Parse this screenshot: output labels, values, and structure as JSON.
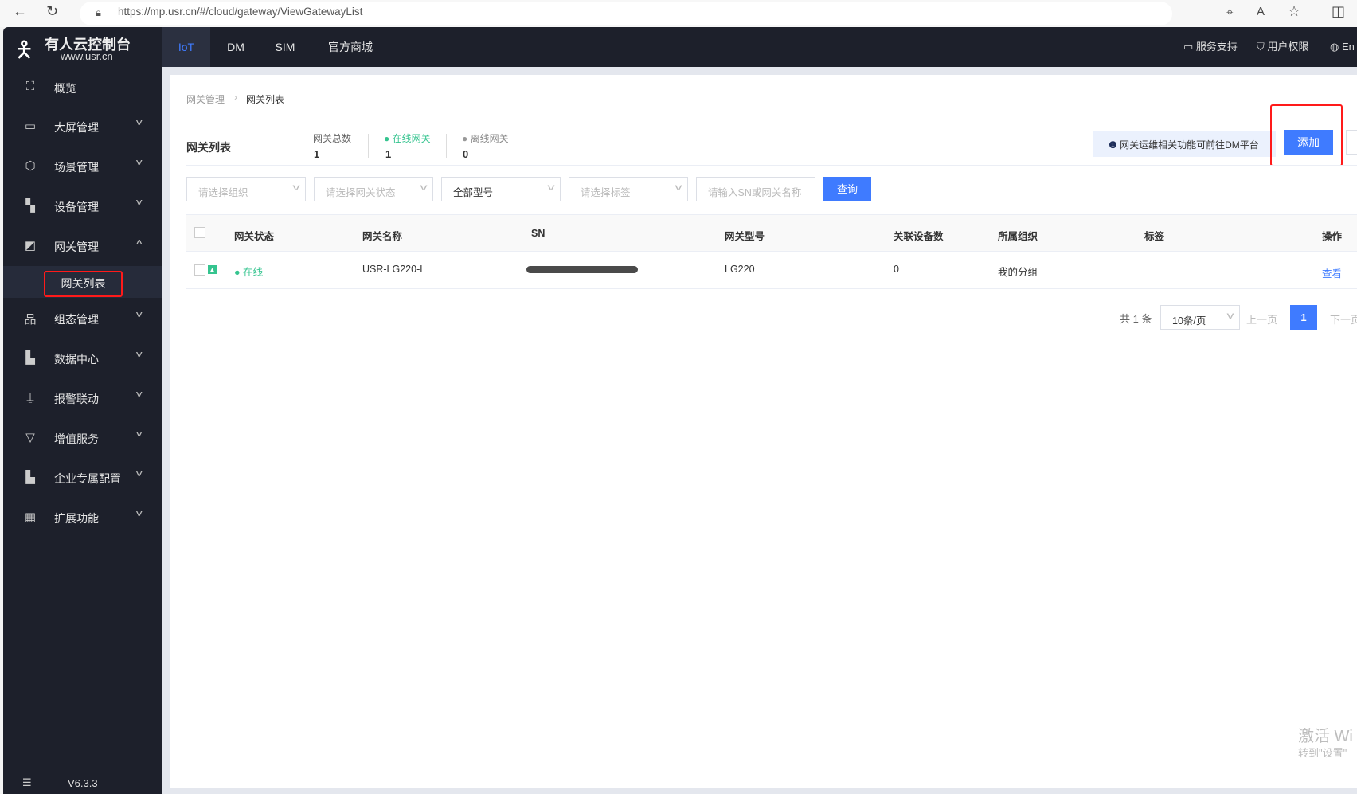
{
  "browser": {
    "url": "https://mp.usr.cn/#/cloud/gateway/ViewGatewayList"
  },
  "logo": {
    "title": "有人云控制台",
    "subtitle": "www.usr.cn"
  },
  "topnav": {
    "tabs": [
      "IoT",
      "DM",
      "SIM",
      "官方商城"
    ],
    "active": "IoT",
    "right": [
      "服务支持",
      "用户权限",
      "En"
    ]
  },
  "sidebar": {
    "items": [
      {
        "label": "概览",
        "icon": "overview-icon"
      },
      {
        "label": "大屏管理",
        "icon": "screen-icon"
      },
      {
        "label": "场景管理",
        "icon": "scene-icon"
      },
      {
        "label": "设备管理",
        "icon": "device-icon"
      },
      {
        "label": "网关管理",
        "icon": "gateway-icon",
        "expanded": true
      },
      {
        "label": "组态管理",
        "icon": "config-icon"
      },
      {
        "label": "数据中心",
        "icon": "data-icon"
      },
      {
        "label": "报警联动",
        "icon": "alarm-icon"
      },
      {
        "label": "增值服务",
        "icon": "service-icon"
      },
      {
        "label": "企业专属配置",
        "icon": "enterprise-icon"
      },
      {
        "label": "扩展功能",
        "icon": "extend-icon"
      }
    ],
    "sub_item": "网关列表",
    "version": "V6.3.3"
  },
  "breadcrumb": [
    "网关管理",
    "网关列表"
  ],
  "page_title": "网关列表",
  "stats": [
    {
      "label": "网关总数",
      "value": "1"
    },
    {
      "label": "在线网关",
      "value": "1"
    },
    {
      "label": "离线网关",
      "value": "0"
    }
  ],
  "info": "网关运维相关功能可前往DM平台",
  "add_button": "添加",
  "filters": {
    "org": "请选择组织",
    "status": "请选择网关状态",
    "model": "全部型号",
    "tag": "请选择标签",
    "search": "请输入SN或网关名称",
    "query": "查询"
  },
  "table": {
    "headers": [
      "网关状态",
      "网关名称",
      "SN",
      "网关型号",
      "关联设备数",
      "所属组织",
      "标签",
      "操作"
    ],
    "rows": [
      {
        "status": "在线",
        "name": "USR-LG220-L",
        "sn": "",
        "model": "LG220",
        "devices": "0",
        "org": "我的分组",
        "tag": "",
        "action": "查看"
      }
    ]
  },
  "pagination": {
    "total": "共 1 条",
    "page_size": "10条/页",
    "prev": "上一页",
    "current": "1",
    "next": "下一页"
  },
  "watermark": {
    "line1": "激活 Wi",
    "line2": "转到\"设置\""
  },
  "colors": {
    "accent": "#3f7bff",
    "online": "#35c48f",
    "dark": "#1d202b",
    "highlight": "#ff1a1a"
  }
}
